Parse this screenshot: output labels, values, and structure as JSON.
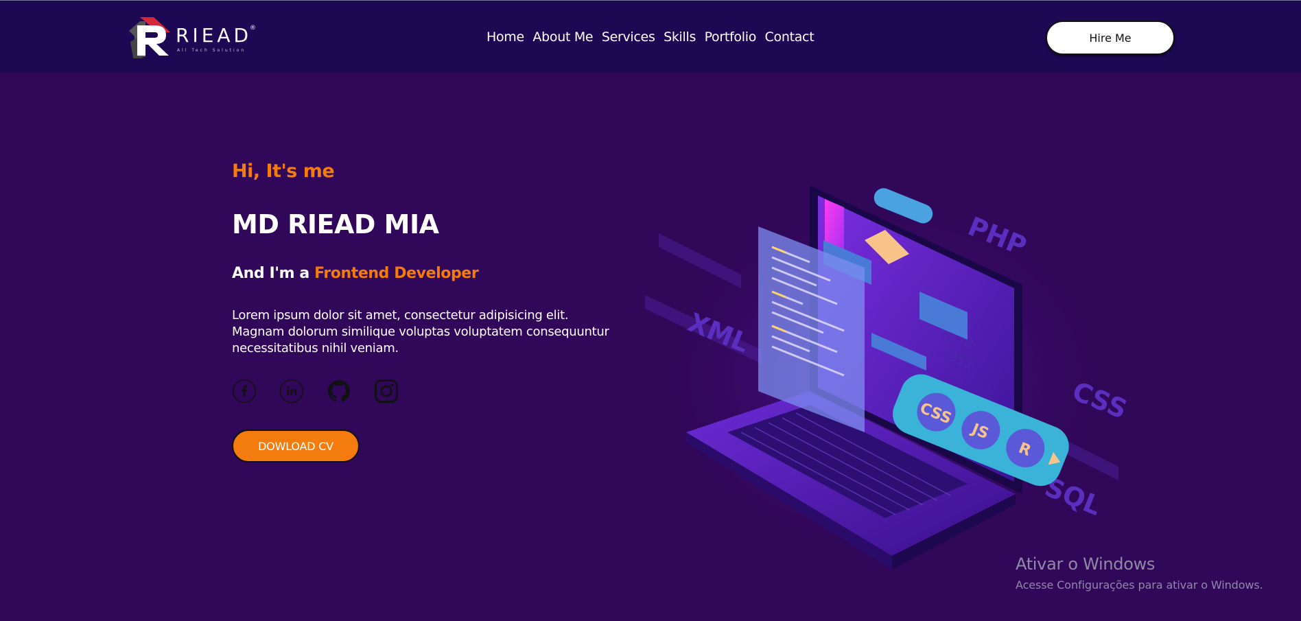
{
  "header": {
    "logo_text": "RIEAD",
    "logo_subtitle": "All Tech Solution",
    "logo_registered": "®",
    "nav": [
      {
        "label": "Home"
      },
      {
        "label": "About Me"
      },
      {
        "label": "Services"
      },
      {
        "label": "Skills"
      },
      {
        "label": "Portfolio"
      },
      {
        "label": "Contact"
      }
    ],
    "hire_label": "Hire Me"
  },
  "hero": {
    "greeting": "Hi, It's me",
    "name": "MD RIEAD MIA",
    "role_prefix": "And I'm a ",
    "role_highlight": "Frontend Developer",
    "description": "Lorem ipsum dolor sit amet, consectetur adipisicing elit. Magnam dolorum similique voluptas voluptatem consequuntur necessitatibus nihil veniam.",
    "socials": [
      {
        "icon": "facebook-icon"
      },
      {
        "icon": "linkedin-icon"
      },
      {
        "icon": "github-icon"
      },
      {
        "icon": "instagram-icon"
      }
    ],
    "cv_label": "DOWLOAD CV"
  },
  "illustration": {
    "labels": [
      "PHP",
      "XML",
      "CSS",
      "SQL",
      "CSS",
      "JS",
      "R"
    ]
  },
  "watermark": {
    "title": "Ativar o Windows",
    "subtitle": "Acesse Configurações para ativar o Windows."
  },
  "colors": {
    "background": "#31075a",
    "header": "#1d0853",
    "accent": "#f47c0e"
  }
}
